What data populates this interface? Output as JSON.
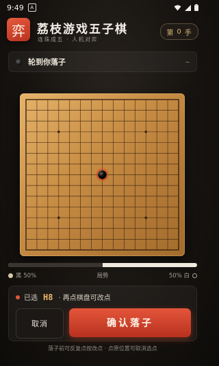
{
  "status_bar": {
    "time": "9:49",
    "notif_icon": "A"
  },
  "header": {
    "logo_char": "弈",
    "title": "荔枝游戏五子棋",
    "subtitle": "连珠成五 · 人机对弈",
    "move_prefix": "第",
    "move_number": "0",
    "move_suffix": "手"
  },
  "turn": {
    "text": "轮到你落子",
    "trailing": "–"
  },
  "board": {
    "size": 15,
    "stones": [
      {
        "col": "H",
        "row": 8,
        "color": "black",
        "selected": true
      }
    ],
    "colors": {
      "wood_light": "#e6b36a",
      "wood_dark": "#a36c2c",
      "line": "#3b2410",
      "selected_ring": "#d6452c"
    }
  },
  "evaluation": {
    "black_label": "黑 50%",
    "center_label": "局势",
    "white_label": "50% 白",
    "black_share": 0.5
  },
  "action_panel": {
    "selected_prefix": "已选",
    "selected_coord": "H8",
    "selected_hint": "· 再点棋盘可改点",
    "cancel_label": "取消",
    "confirm_label": "确认落子"
  },
  "footer": {
    "hint": "落子前可反复点按改点 · 点原位置可取消选点"
  },
  "colors": {
    "accent": "#d84a30",
    "gold": "#e9b866"
  }
}
